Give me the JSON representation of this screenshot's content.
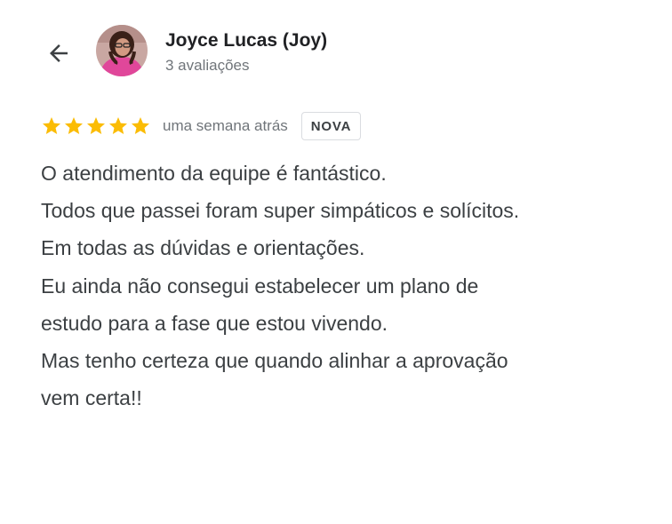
{
  "reviewer": {
    "name": "Joyce Lucas (Joy)",
    "reviews_count": "3 avaliações"
  },
  "review": {
    "rating": 5,
    "time_ago": "uma semana atrás",
    "badge": "NOVA",
    "lines": [
      "O atendimento da equipe é fantástico.",
      "Todos que passei foram super simpáticos e solícitos.",
      "Em todas as dúvidas e orientações.",
      "Eu ainda não consegui estabelecer um plano de",
      "estudo para a fase que estou vivendo.",
      "Mas tenho certeza que quando alinhar a aprovação",
      "vem certa!!"
    ]
  },
  "colors": {
    "star": "#fbbc04",
    "name": "#202124",
    "text": "#3c4043",
    "secondary": "#70757a",
    "badge_border": "#dadce0"
  },
  "icons": {
    "back": "arrow-back-icon",
    "star": "star-icon"
  }
}
